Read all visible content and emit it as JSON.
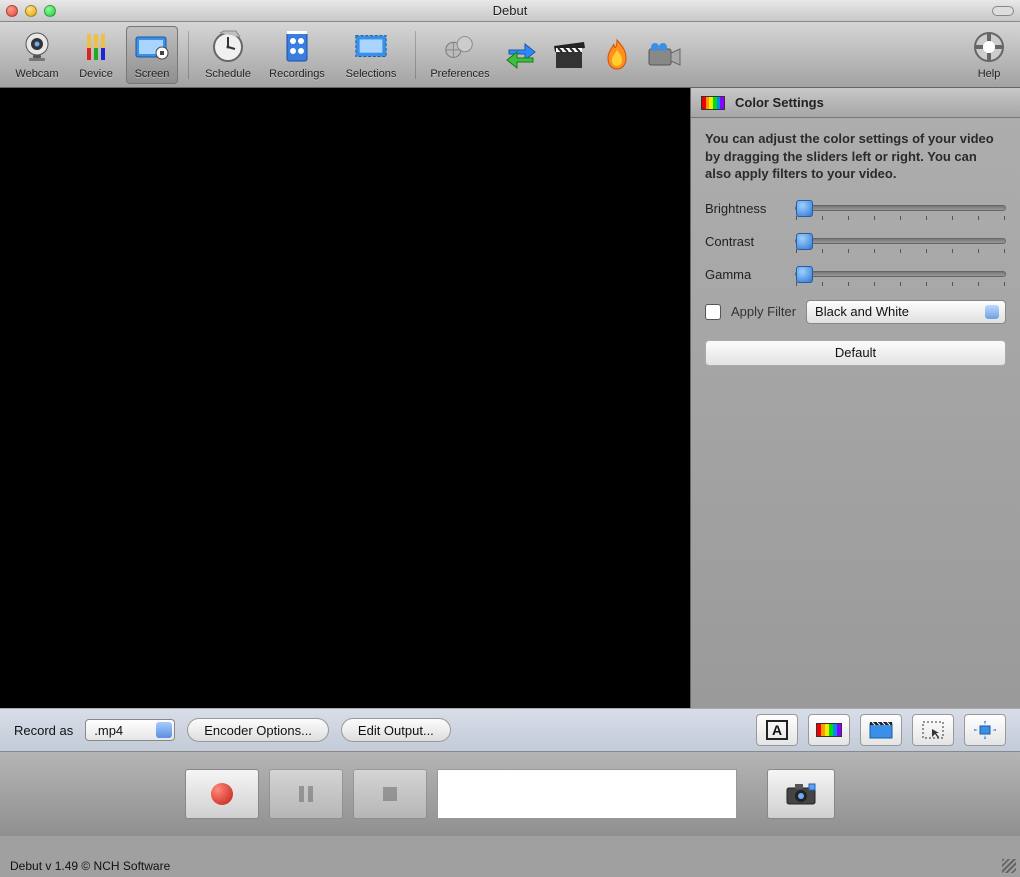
{
  "window": {
    "title": "Debut"
  },
  "toolbar": {
    "items": [
      {
        "label": "Webcam"
      },
      {
        "label": "Device"
      },
      {
        "label": "Screen"
      },
      {
        "label": "Schedule"
      },
      {
        "label": "Recordings"
      },
      {
        "label": "Selections"
      },
      {
        "label": "Preferences"
      },
      {
        "label": "Help"
      }
    ]
  },
  "color_panel": {
    "title": "Color Settings",
    "description": "You can adjust the color settings of your video by dragging the sliders left or right. You can also apply filters to your video.",
    "sliders": {
      "brightness": "Brightness",
      "contrast": "Contrast",
      "gamma": "Gamma"
    },
    "apply_filter_label": "Apply Filter",
    "filter_selected": "Black and White",
    "default_button": "Default"
  },
  "options": {
    "record_as_label": "Record as",
    "format": ".mp4",
    "encoder_button": "Encoder Options...",
    "edit_output_button": "Edit Output..."
  },
  "footer": {
    "text": "Debut v 1.49 © NCH Software"
  }
}
